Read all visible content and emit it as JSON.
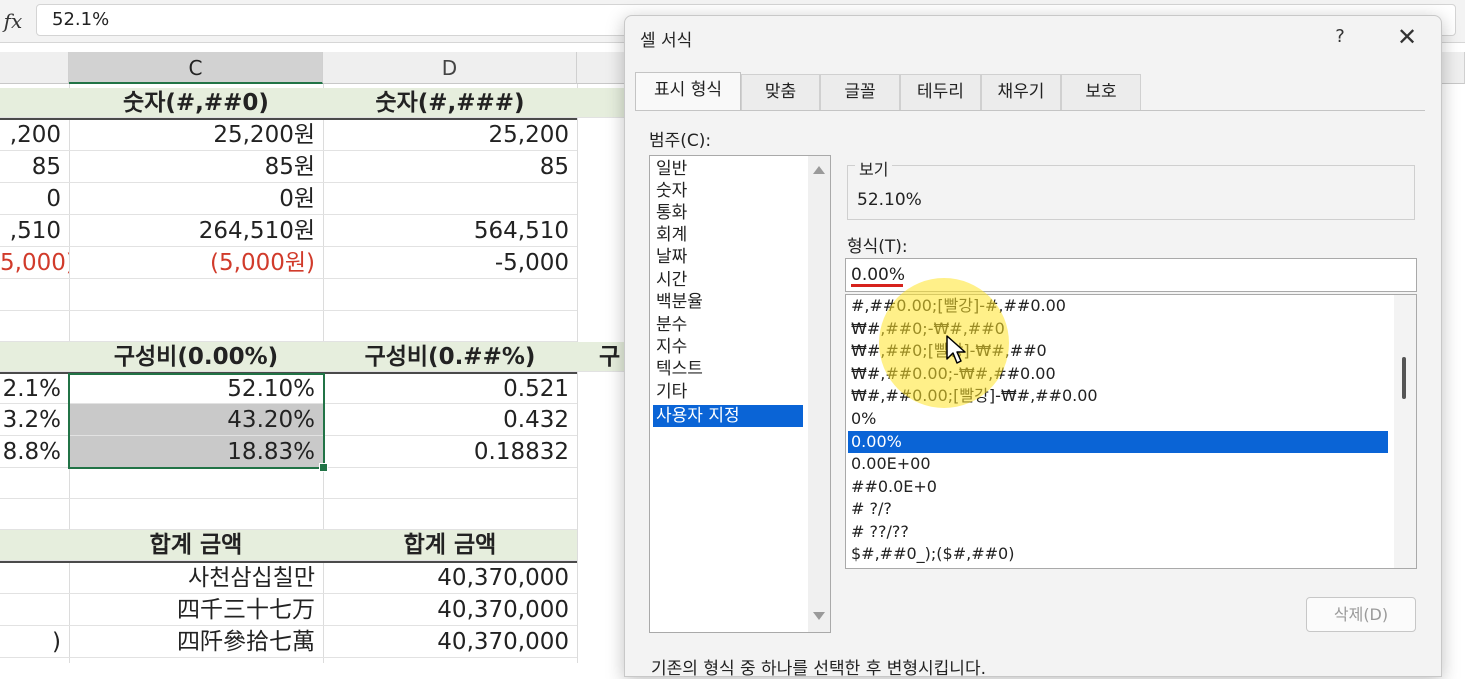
{
  "formula_bar": {
    "fx": "fx",
    "value": "52.1%"
  },
  "columns": {
    "c": "C",
    "d": "D"
  },
  "sheet": {
    "section1": {
      "header_c": "숫자(#,##0)",
      "header_d": "숫자(#,###)",
      "col_b": [
        ",200",
        "85",
        "0",
        ",510",
        "5,000)"
      ],
      "col_c": [
        "25,200원",
        "85원",
        "0원",
        "264,510원",
        "(5,000원)"
      ],
      "col_d": [
        "25,200",
        "85",
        "",
        "564,510",
        "-5,000"
      ]
    },
    "section2": {
      "header_c": "구성비(0.00%)",
      "header_d": "구성비(0.##%)",
      "header_e_partial": "구",
      "col_b": [
        "2.1%",
        "3.2%",
        "8.8%"
      ],
      "col_c": [
        "52.10%",
        "43.20%",
        "18.83%"
      ],
      "col_d": [
        "0.521",
        "0.432",
        "0.18832"
      ]
    },
    "section3": {
      "header_c": "합계 금액",
      "header_d": "합계 금액",
      "col_b": [
        "",
        "",
        ")"
      ],
      "col_c": [
        "사천삼십칠만",
        "四千三十七万",
        "四阡參拾七萬"
      ],
      "col_d": [
        "40,370,000",
        "40,370,000",
        "40,370,000"
      ]
    }
  },
  "dialog": {
    "title": "셀 서식",
    "help": "?",
    "close": "✕",
    "tabs": [
      "표시 형식",
      "맞춤",
      "글꼴",
      "테두리",
      "채우기",
      "보호"
    ],
    "category_label": "범주(C):",
    "categories": [
      "일반",
      "숫자",
      "통화",
      "회계",
      "날짜",
      "시간",
      "백분율",
      "분수",
      "지수",
      "텍스트",
      "기타",
      "사용자 지정"
    ],
    "selected_category": "사용자 지정",
    "preview_label": "보기",
    "preview_value": "52.10%",
    "format_label": "형식(T):",
    "format_value": "0.00%",
    "formats": [
      "#,##0.00;[빨강]-#,##0.00",
      "₩#,##0;-₩#,##0",
      "₩#,##0;[빨강]-₩#,##0",
      "₩#,##0.00;-₩#,##0.00",
      "₩#,##0.00;[빨강]-₩#,##0.00",
      "0%",
      "0.00%",
      "0.00E+00",
      "##0.0E+0",
      "# ?/?",
      "# ??/??",
      "$#,##0_);($#,##0)"
    ],
    "selected_format": "0.00%",
    "delete_button": "삭제(D)",
    "footer_note": "기존의 형식 중 하나를 선택한 후 변형시킵니다."
  },
  "colors": {
    "accent_green": "#217346",
    "selection_blue": "#0a64d6",
    "negative_red": "#d13b2b",
    "highlight_yellow": "#ffe428"
  }
}
